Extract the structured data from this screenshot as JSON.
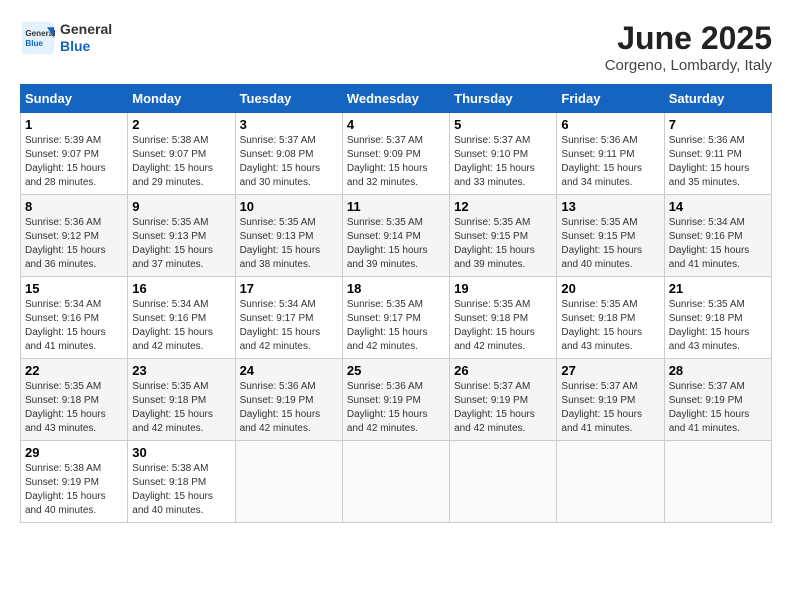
{
  "header": {
    "logo_general": "General",
    "logo_blue": "Blue",
    "month_year": "June 2025",
    "location": "Corgeno, Lombardy, Italy"
  },
  "calendar": {
    "days_of_week": [
      "Sunday",
      "Monday",
      "Tuesday",
      "Wednesday",
      "Thursday",
      "Friday",
      "Saturday"
    ],
    "weeks": [
      [
        {
          "day": "1",
          "sunrise": "Sunrise: 5:39 AM",
          "sunset": "Sunset: 9:07 PM",
          "daylight": "Daylight: 15 hours and 28 minutes."
        },
        {
          "day": "2",
          "sunrise": "Sunrise: 5:38 AM",
          "sunset": "Sunset: 9:07 PM",
          "daylight": "Daylight: 15 hours and 29 minutes."
        },
        {
          "day": "3",
          "sunrise": "Sunrise: 5:37 AM",
          "sunset": "Sunset: 9:08 PM",
          "daylight": "Daylight: 15 hours and 30 minutes."
        },
        {
          "day": "4",
          "sunrise": "Sunrise: 5:37 AM",
          "sunset": "Sunset: 9:09 PM",
          "daylight": "Daylight: 15 hours and 32 minutes."
        },
        {
          "day": "5",
          "sunrise": "Sunrise: 5:37 AM",
          "sunset": "Sunset: 9:10 PM",
          "daylight": "Daylight: 15 hours and 33 minutes."
        },
        {
          "day": "6",
          "sunrise": "Sunrise: 5:36 AM",
          "sunset": "Sunset: 9:11 PM",
          "daylight": "Daylight: 15 hours and 34 minutes."
        },
        {
          "day": "7",
          "sunrise": "Sunrise: 5:36 AM",
          "sunset": "Sunset: 9:11 PM",
          "daylight": "Daylight: 15 hours and 35 minutes."
        }
      ],
      [
        {
          "day": "8",
          "sunrise": "Sunrise: 5:36 AM",
          "sunset": "Sunset: 9:12 PM",
          "daylight": "Daylight: 15 hours and 36 minutes."
        },
        {
          "day": "9",
          "sunrise": "Sunrise: 5:35 AM",
          "sunset": "Sunset: 9:13 PM",
          "daylight": "Daylight: 15 hours and 37 minutes."
        },
        {
          "day": "10",
          "sunrise": "Sunrise: 5:35 AM",
          "sunset": "Sunset: 9:13 PM",
          "daylight": "Daylight: 15 hours and 38 minutes."
        },
        {
          "day": "11",
          "sunrise": "Sunrise: 5:35 AM",
          "sunset": "Sunset: 9:14 PM",
          "daylight": "Daylight: 15 hours and 39 minutes."
        },
        {
          "day": "12",
          "sunrise": "Sunrise: 5:35 AM",
          "sunset": "Sunset: 9:15 PM",
          "daylight": "Daylight: 15 hours and 39 minutes."
        },
        {
          "day": "13",
          "sunrise": "Sunrise: 5:35 AM",
          "sunset": "Sunset: 9:15 PM",
          "daylight": "Daylight: 15 hours and 40 minutes."
        },
        {
          "day": "14",
          "sunrise": "Sunrise: 5:34 AM",
          "sunset": "Sunset: 9:16 PM",
          "daylight": "Daylight: 15 hours and 41 minutes."
        }
      ],
      [
        {
          "day": "15",
          "sunrise": "Sunrise: 5:34 AM",
          "sunset": "Sunset: 9:16 PM",
          "daylight": "Daylight: 15 hours and 41 minutes."
        },
        {
          "day": "16",
          "sunrise": "Sunrise: 5:34 AM",
          "sunset": "Sunset: 9:16 PM",
          "daylight": "Daylight: 15 hours and 42 minutes."
        },
        {
          "day": "17",
          "sunrise": "Sunrise: 5:34 AM",
          "sunset": "Sunset: 9:17 PM",
          "daylight": "Daylight: 15 hours and 42 minutes."
        },
        {
          "day": "18",
          "sunrise": "Sunrise: 5:35 AM",
          "sunset": "Sunset: 9:17 PM",
          "daylight": "Daylight: 15 hours and 42 minutes."
        },
        {
          "day": "19",
          "sunrise": "Sunrise: 5:35 AM",
          "sunset": "Sunset: 9:18 PM",
          "daylight": "Daylight: 15 hours and 42 minutes."
        },
        {
          "day": "20",
          "sunrise": "Sunrise: 5:35 AM",
          "sunset": "Sunset: 9:18 PM",
          "daylight": "Daylight: 15 hours and 43 minutes."
        },
        {
          "day": "21",
          "sunrise": "Sunrise: 5:35 AM",
          "sunset": "Sunset: 9:18 PM",
          "daylight": "Daylight: 15 hours and 43 minutes."
        }
      ],
      [
        {
          "day": "22",
          "sunrise": "Sunrise: 5:35 AM",
          "sunset": "Sunset: 9:18 PM",
          "daylight": "Daylight: 15 hours and 43 minutes."
        },
        {
          "day": "23",
          "sunrise": "Sunrise: 5:35 AM",
          "sunset": "Sunset: 9:18 PM",
          "daylight": "Daylight: 15 hours and 42 minutes."
        },
        {
          "day": "24",
          "sunrise": "Sunrise: 5:36 AM",
          "sunset": "Sunset: 9:19 PM",
          "daylight": "Daylight: 15 hours and 42 minutes."
        },
        {
          "day": "25",
          "sunrise": "Sunrise: 5:36 AM",
          "sunset": "Sunset: 9:19 PM",
          "daylight": "Daylight: 15 hours and 42 minutes."
        },
        {
          "day": "26",
          "sunrise": "Sunrise: 5:37 AM",
          "sunset": "Sunset: 9:19 PM",
          "daylight": "Daylight: 15 hours and 42 minutes."
        },
        {
          "day": "27",
          "sunrise": "Sunrise: 5:37 AM",
          "sunset": "Sunset: 9:19 PM",
          "daylight": "Daylight: 15 hours and 41 minutes."
        },
        {
          "day": "28",
          "sunrise": "Sunrise: 5:37 AM",
          "sunset": "Sunset: 9:19 PM",
          "daylight": "Daylight: 15 hours and 41 minutes."
        }
      ],
      [
        {
          "day": "29",
          "sunrise": "Sunrise: 5:38 AM",
          "sunset": "Sunset: 9:19 PM",
          "daylight": "Daylight: 15 hours and 40 minutes."
        },
        {
          "day": "30",
          "sunrise": "Sunrise: 5:38 AM",
          "sunset": "Sunset: 9:18 PM",
          "daylight": "Daylight: 15 hours and 40 minutes."
        },
        null,
        null,
        null,
        null,
        null
      ]
    ]
  }
}
